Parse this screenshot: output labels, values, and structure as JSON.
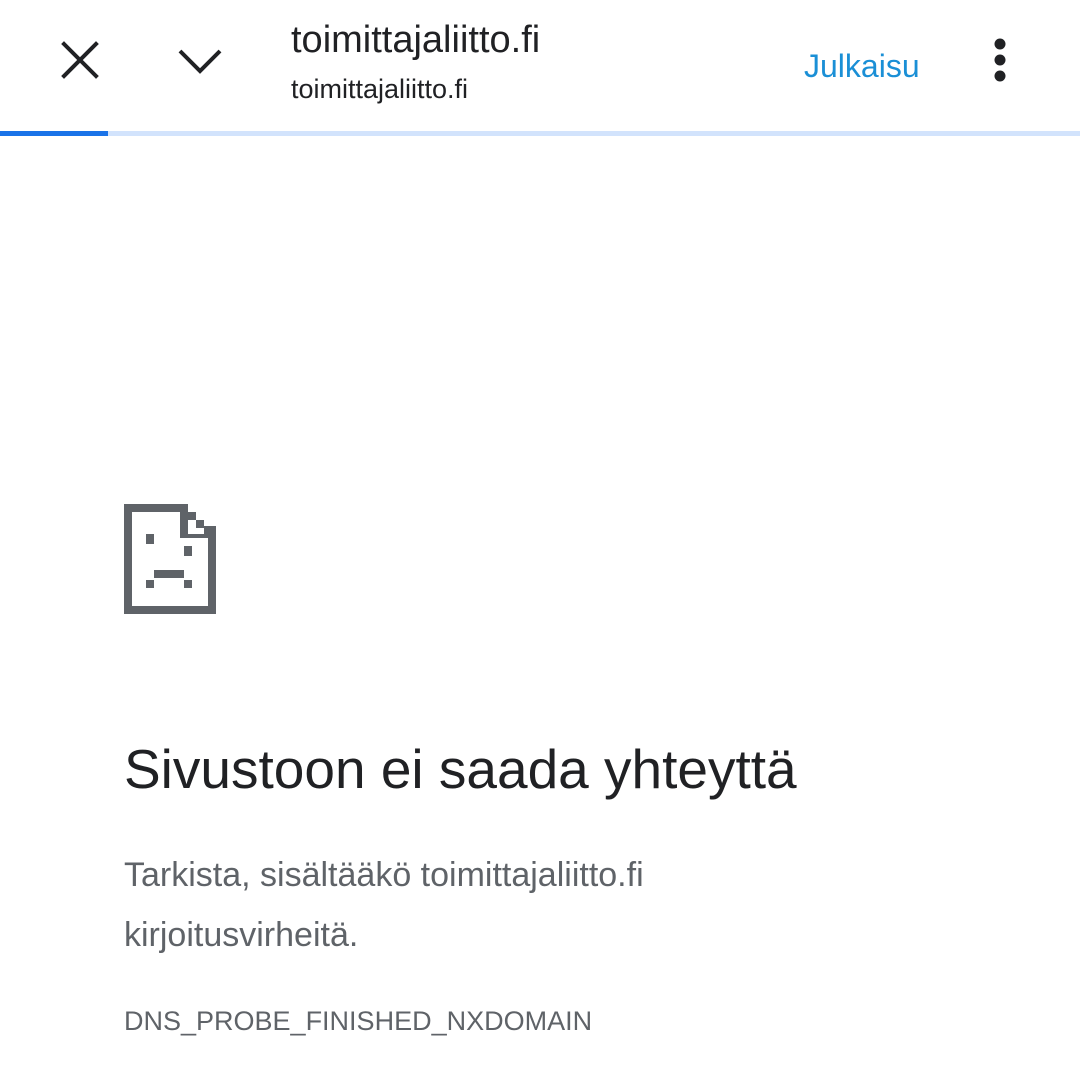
{
  "toolbar": {
    "title": "toimittajaliitto.fi",
    "url": "toimittajaliitto.fi",
    "publish_label": "Julkaisu",
    "icons": {
      "close": "close-icon",
      "chevron": "chevron-down-icon",
      "menu": "more-vertical-icon"
    },
    "accent_color": "#1a8fd6"
  },
  "progress": {
    "fraction": 0.1
  },
  "error": {
    "icon": "sad-page-icon",
    "heading": "Sivustoon ei saada yhteyttä",
    "message": "Tarkista, sisältääkö toimittajaliitto.fi kirjoitusvirheitä.",
    "code": "DNS_PROBE_FINISHED_NXDOMAIN"
  }
}
